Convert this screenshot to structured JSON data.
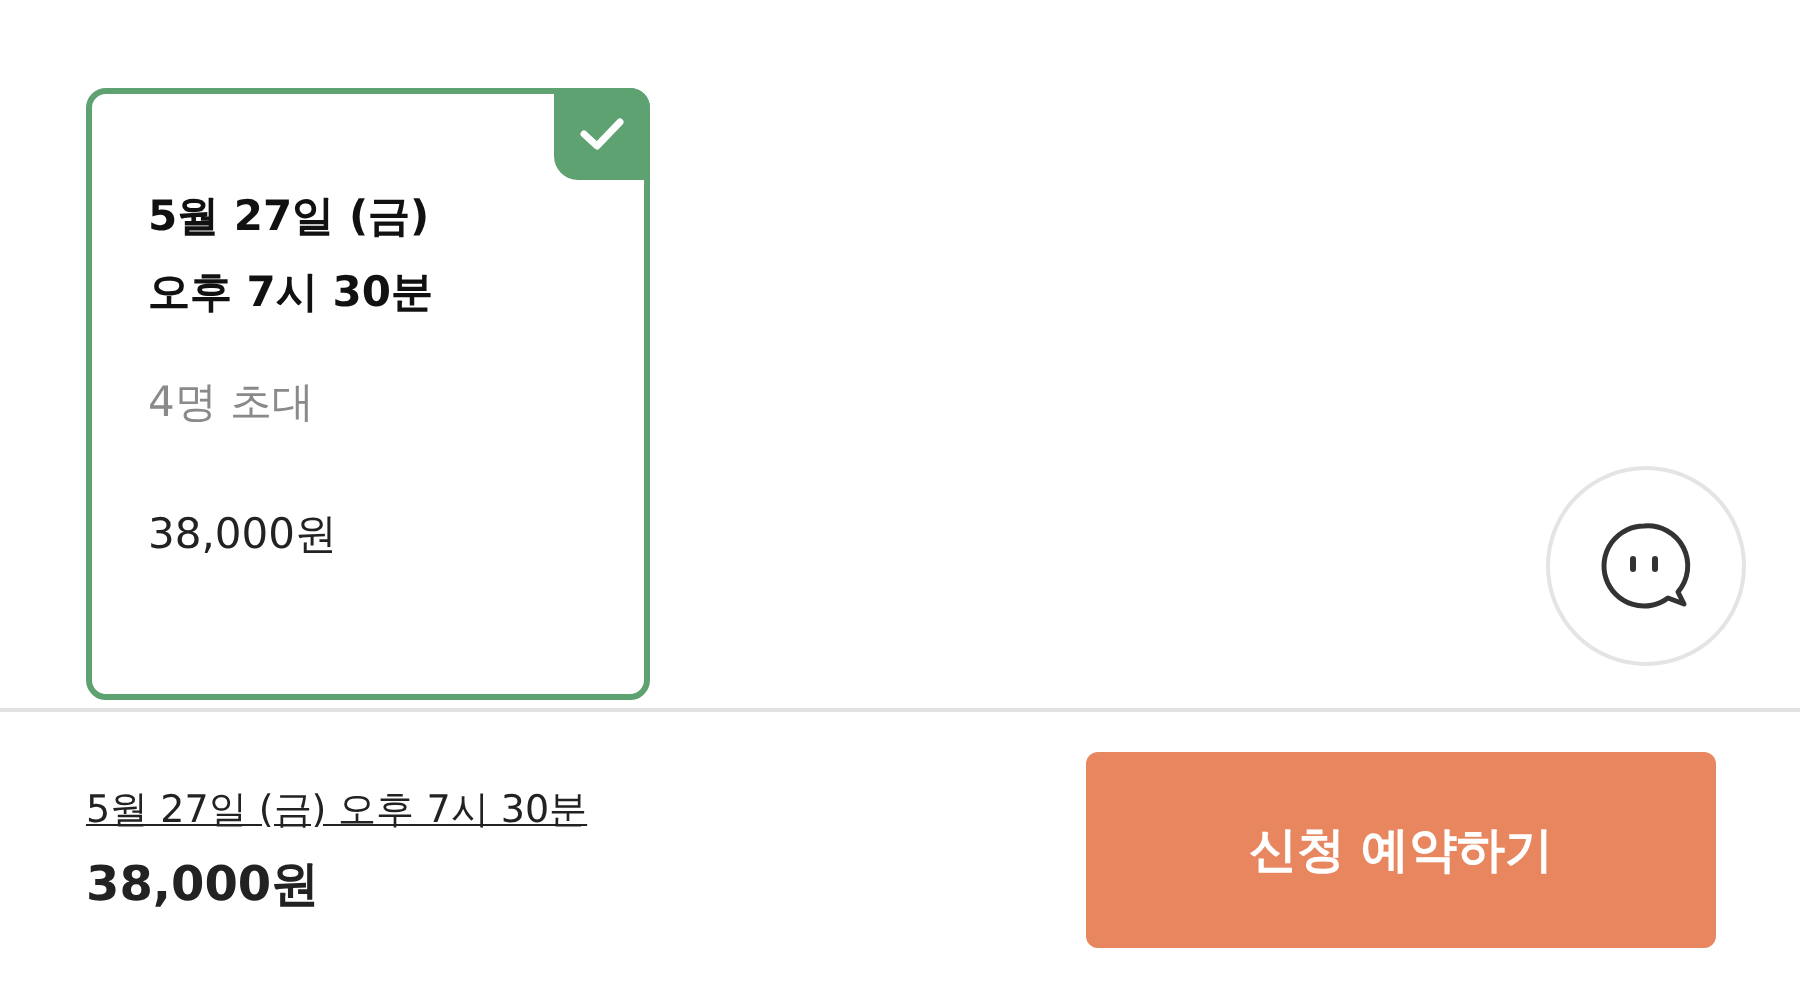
{
  "options": [
    {
      "date": "5월 27일 (금)",
      "time": "오후 7시 30분",
      "guests": "4명 초대",
      "price": "38,000원",
      "selected": true
    }
  ],
  "summary": {
    "schedule": "5월 27일 (금) 오후 7시 30분",
    "price": "38,000원"
  },
  "reserve_button": {
    "label": "신청 예약하기"
  }
}
